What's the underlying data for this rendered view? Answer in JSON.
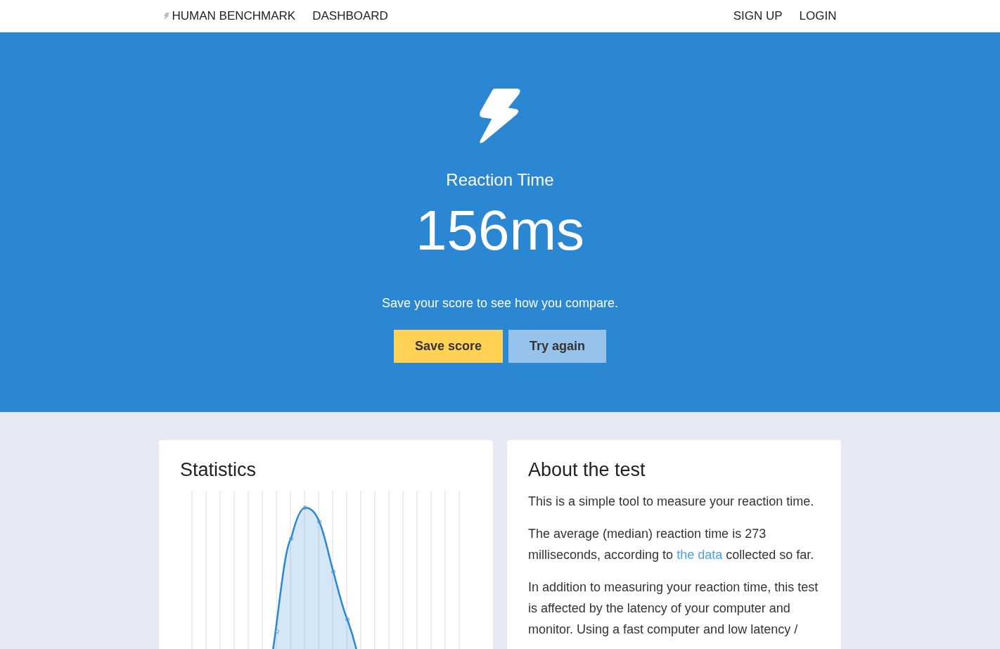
{
  "navbar": {
    "brand": "HUMAN BENCHMARK",
    "left_links": [
      "DASHBOARD"
    ],
    "right_links": [
      "SIGN UP",
      "LOGIN"
    ]
  },
  "hero": {
    "title": "Reaction Time",
    "score": "156ms",
    "message": "Save your score to see how you compare.",
    "buttons": [
      {
        "label": "Save score",
        "kind": "primary"
      },
      {
        "label": "Try again",
        "kind": "secondary"
      }
    ]
  },
  "statistics": {
    "title": "Statistics"
  },
  "about": {
    "title": "About the test",
    "paragraphs": [
      {
        "text": "This is a simple tool to measure your reaction time."
      },
      {
        "text": "The average (median) reaction time is 273 milliseconds, according to",
        "link": "the data",
        "text_after": "collected so far."
      },
      {
        "text": "In addition to measuring your reaction time, this test is affected by the latency of your computer and monitor. Using a fast computer and low latency /"
      }
    ]
  }
}
